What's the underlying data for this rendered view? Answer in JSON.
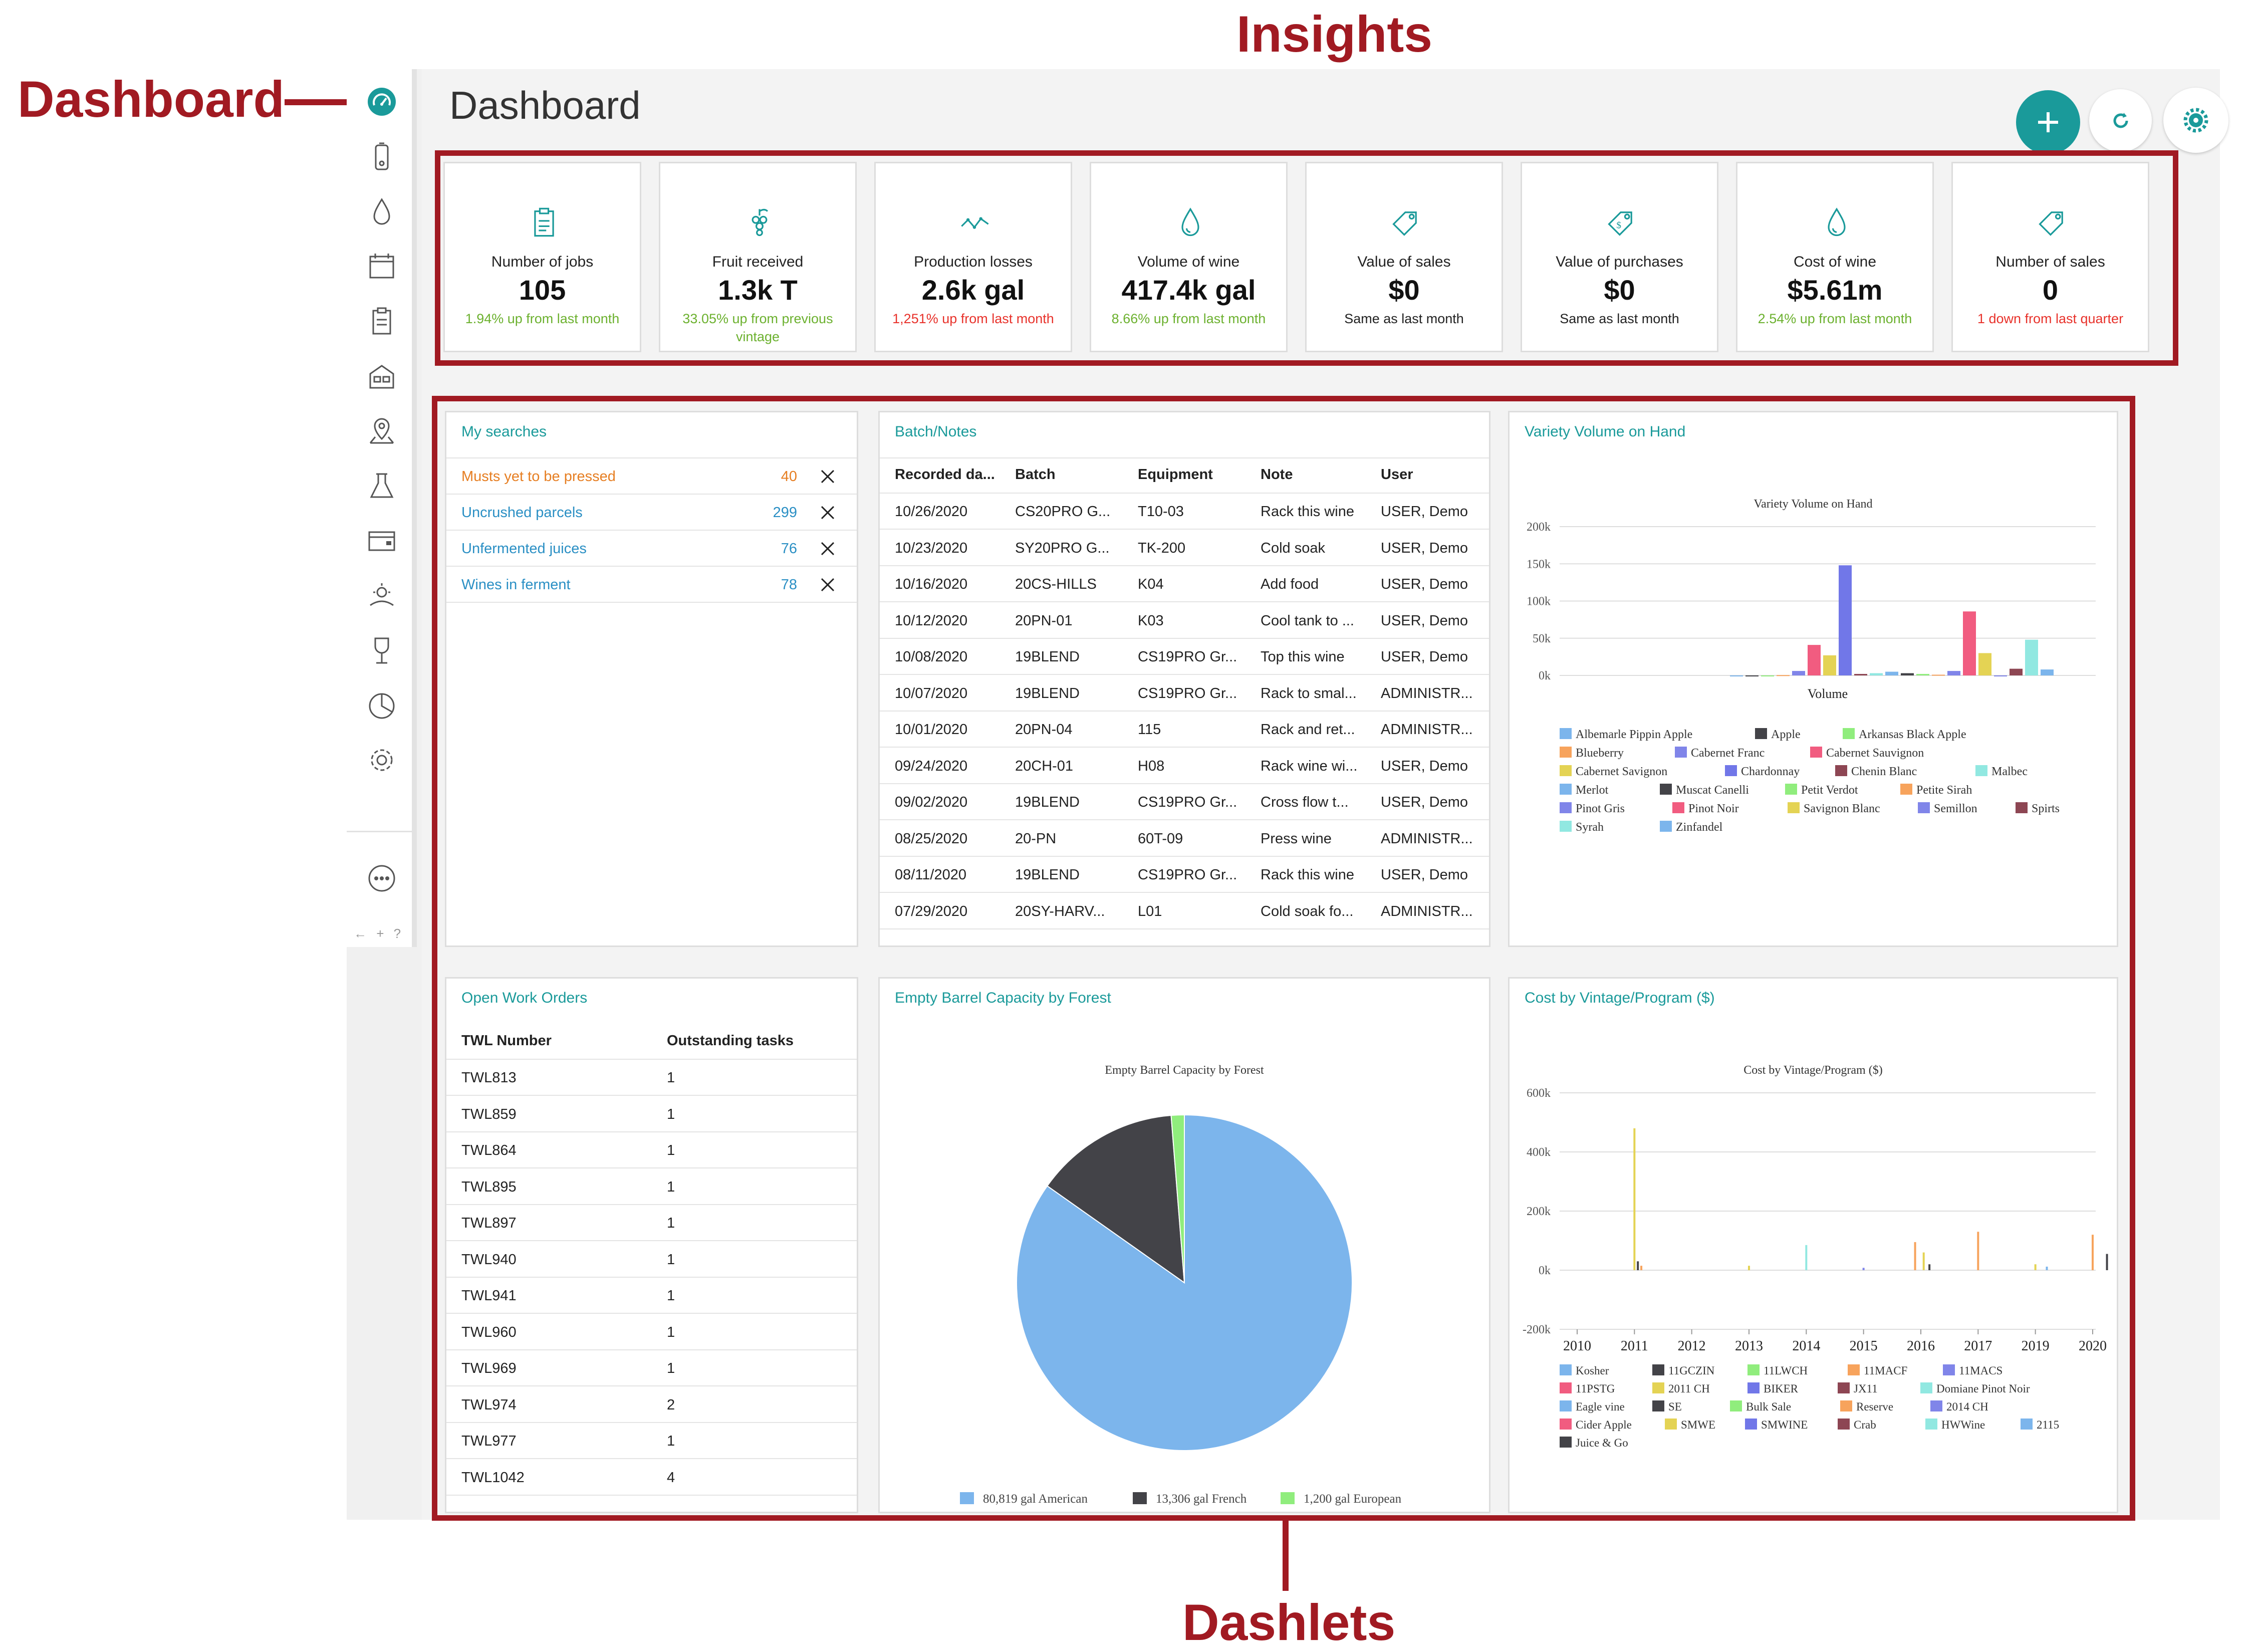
{
  "annotations": {
    "dashboard": "Dashboard",
    "insights": "Insights",
    "dashlets": "Dashlets"
  },
  "page": {
    "title": "Dashboard",
    "footer_icons": "← + ?"
  },
  "colors": {
    "teal": "#1a9a9a",
    "annotation": "#a11a22",
    "green": "#6cb12f",
    "red": "#e8322b",
    "orange": "#e67e22"
  },
  "insights": [
    {
      "title": "Number of jobs",
      "value": "105",
      "trend": "1.94% up from last month",
      "status": "green",
      "icon": "clipboard-icon"
    },
    {
      "title": "Fruit received",
      "value": "1.3k T",
      "trend": "33.05% up from previous vintage",
      "status": "green",
      "icon": "grapes-icon"
    },
    {
      "title": "Production losses",
      "value": "2.6k gal",
      "trend": "1,251% up from last month",
      "status": "red",
      "icon": "trend-line-icon"
    },
    {
      "title": "Volume of wine",
      "value": "417.4k gal",
      "trend": "8.66% up from last month",
      "status": "green",
      "icon": "droplet-icon"
    },
    {
      "title": "Value of sales",
      "value": "$0",
      "trend": "Same as last month",
      "status": "dark",
      "icon": "tag-icon"
    },
    {
      "title": "Value of purchases",
      "value": "$0",
      "trend": "Same as last month",
      "status": "dark",
      "icon": "price-tag-icon"
    },
    {
      "title": "Cost of wine",
      "value": "$5.61m",
      "trend": "2.54% up from last month",
      "status": "green",
      "icon": "droplet-icon"
    },
    {
      "title": "Number of sales",
      "value": "0",
      "trend": "1 down from last quarter",
      "status": "red",
      "icon": "tag-icon"
    }
  ],
  "my_searches": {
    "title": "My searches",
    "items": [
      {
        "label": "Musts yet to be pressed",
        "count": "40",
        "color": "#e67e22"
      },
      {
        "label": "Uncrushed parcels",
        "count": "299",
        "color": "#2a8fc4"
      },
      {
        "label": "Unfermented juices",
        "count": "76",
        "color": "#2a8fc4"
      },
      {
        "label": "Wines in ferment",
        "count": "78",
        "color": "#2a8fc4"
      }
    ]
  },
  "batch_notes": {
    "title": "Batch/Notes",
    "headers": [
      "Recorded da...",
      "Batch",
      "Equipment",
      "Note",
      "User"
    ],
    "rows": [
      [
        "10/26/2020",
        "CS20PRO G...",
        "T10-03",
        "Rack this wine",
        "USER, Demo"
      ],
      [
        "10/23/2020",
        "SY20PRO G...",
        "TK-200",
        "Cold soak",
        "USER, Demo"
      ],
      [
        "10/16/2020",
        "20CS-HILLS",
        "K04",
        "Add food",
        "USER, Demo"
      ],
      [
        "10/12/2020",
        "20PN-01",
        "K03",
        "Cool tank to ...",
        "USER, Demo"
      ],
      [
        "10/08/2020",
        "19BLEND",
        "CS19PRO Gr...",
        "Top this wine",
        "USER, Demo"
      ],
      [
        "10/07/2020",
        "19BLEND",
        "CS19PRO Gr...",
        "Rack to smal...",
        "ADMINISTR..."
      ],
      [
        "10/01/2020",
        "20PN-04",
        "115",
        "Rack and ret...",
        "ADMINISTR..."
      ],
      [
        "09/24/2020",
        "20CH-01",
        "H08",
        "Rack wine wi...",
        "USER, Demo"
      ],
      [
        "09/02/2020",
        "19BLEND",
        "CS19PRO Gr...",
        "Cross flow t...",
        "USER, Demo"
      ],
      [
        "08/25/2020",
        "20-PN",
        "60T-09",
        "Press wine",
        "ADMINISTR..."
      ],
      [
        "08/11/2020",
        "19BLEND",
        "CS19PRO Gr...",
        "Rack this wine",
        "USER, Demo"
      ],
      [
        "07/29/2020",
        "20SY-HARV...",
        "L01",
        "Cold soak fo...",
        "ADMINISTR..."
      ]
    ]
  },
  "work_orders": {
    "title": "Open Work Orders",
    "headers": [
      "TWL Number",
      "Outstanding tasks"
    ],
    "rows": [
      [
        "TWL813",
        "1"
      ],
      [
        "TWL859",
        "1"
      ],
      [
        "TWL864",
        "1"
      ],
      [
        "TWL895",
        "1"
      ],
      [
        "TWL897",
        "1"
      ],
      [
        "TWL940",
        "1"
      ],
      [
        "TWL941",
        "1"
      ],
      [
        "TWL960",
        "1"
      ],
      [
        "TWL969",
        "1"
      ],
      [
        "TWL974",
        "2"
      ],
      [
        "TWL977",
        "1"
      ],
      [
        "TWL1042",
        "4"
      ]
    ]
  },
  "variety_dashlet": {
    "title": "Variety Volume on Hand"
  },
  "barrel_dashlet": {
    "title": "Empty Barrel Capacity by Forest"
  },
  "cost_dashlet": {
    "title": "Cost by Vintage/Program ($)"
  },
  "chart_data": [
    {
      "type": "bar",
      "title": "Variety Volume on Hand",
      "xlabel": "Volume",
      "ylim": [
        0,
        200000
      ],
      "yticks": [
        "0k",
        "50k",
        "100k",
        "150k",
        "200k"
      ],
      "series": [
        {
          "name": "Albemarle Pippin Apple",
          "values": [
            0
          ],
          "color": "#7cb5ec"
        },
        {
          "name": "Apple",
          "values": [
            0
          ],
          "color": "#434348"
        },
        {
          "name": "Arkansas Black Apple",
          "values": [
            0
          ],
          "color": "#90ed7d"
        },
        {
          "name": "Blueberry",
          "values": [
            500
          ],
          "color": "#f7a35c"
        },
        {
          "name": "Cabernet Franc",
          "values": [
            6000
          ],
          "color": "#8085e9"
        },
        {
          "name": "Cabernet Sauvignon",
          "values": [
            41000
          ],
          "color": "#f15c80"
        },
        {
          "name": "Cabernet Savignon",
          "values": [
            27000
          ],
          "color": "#e4d354"
        },
        {
          "name": "Chardonnay",
          "values": [
            148000
          ],
          "color": "#7177e8"
        },
        {
          "name": "Chenin Blanc",
          "values": [
            2000
          ],
          "color": "#8d4653"
        },
        {
          "name": "Malbec",
          "values": [
            3000
          ],
          "color": "#91e8e1"
        },
        {
          "name": "Merlot",
          "values": [
            5000
          ],
          "color": "#7cb5ec"
        },
        {
          "name": "Muscat Canelli",
          "values": [
            3000
          ],
          "color": "#434348"
        },
        {
          "name": "Petit Verdot",
          "values": [
            2000
          ],
          "color": "#90ed7d"
        },
        {
          "name": "Petite Sirah",
          "values": [
            1000
          ],
          "color": "#f7a35c"
        },
        {
          "name": "Pinot Gris",
          "values": [
            6000
          ],
          "color": "#8085e9"
        },
        {
          "name": "Pinot Noir",
          "values": [
            86000
          ],
          "color": "#f15c80"
        },
        {
          "name": "Savignon Blanc",
          "values": [
            30000
          ],
          "color": "#e4d354"
        },
        {
          "name": "Semillon",
          "values": [
            0
          ],
          "color": "#8085e9"
        },
        {
          "name": "Spirts",
          "values": [
            9000
          ],
          "color": "#8d4653"
        },
        {
          "name": "Syrah",
          "values": [
            48000
          ],
          "color": "#91e8e1"
        },
        {
          "name": "Zinfandel",
          "values": [
            8000
          ],
          "color": "#7cb5ec"
        }
      ]
    },
    {
      "type": "pie",
      "title": "Empty Barrel Capacity by Forest",
      "slices": [
        {
          "label": "80,819 gal American",
          "value": 80819,
          "color": "#7cb5ec"
        },
        {
          "label": "13,306 gal French",
          "value": 13306,
          "color": "#434348"
        },
        {
          "label": "1,200 gal European",
          "value": 1200,
          "color": "#90ed7d"
        }
      ]
    },
    {
      "type": "bar",
      "title": "Cost by Vintage/Program ($)",
      "ylim": [
        -200000,
        600000
      ],
      "yticks": [
        "-200k",
        "0k",
        "200k",
        "400k",
        "600k"
      ],
      "categories": [
        "2010",
        "2011",
        "2012",
        "2013",
        "2014",
        "2015",
        "2016",
        "2017",
        "2019",
        "2020"
      ],
      "series": [
        {
          "name": "Kosher",
          "color": "#7cb5ec"
        },
        {
          "name": "11GCZIN",
          "color": "#434348"
        },
        {
          "name": "11LWCH",
          "color": "#90ed7d"
        },
        {
          "name": "11MACF",
          "color": "#f7a35c"
        },
        {
          "name": "11MACS",
          "color": "#8085e9"
        },
        {
          "name": "11PSTG",
          "color": "#f15c80"
        },
        {
          "name": "2011 CH",
          "color": "#e4d354"
        },
        {
          "name": "BIKER",
          "color": "#7177e8"
        },
        {
          "name": "JX11",
          "color": "#8d4653"
        },
        {
          "name": "Domiane Pinot Noir",
          "color": "#91e8e1"
        },
        {
          "name": "Eagle vine",
          "color": "#7cb5ec"
        },
        {
          "name": "SE",
          "color": "#434348"
        },
        {
          "name": "Bulk Sale",
          "color": "#90ed7d"
        },
        {
          "name": "Reserve",
          "color": "#f7a35c"
        },
        {
          "name": "2014 CH",
          "color": "#8085e9"
        },
        {
          "name": "Cider Apple",
          "color": "#f15c80"
        },
        {
          "name": "SMWE",
          "color": "#e4d354"
        },
        {
          "name": "SMWINE",
          "color": "#7177e8"
        },
        {
          "name": "Crab",
          "color": "#8d4653"
        },
        {
          "name": "HWWine",
          "color": "#91e8e1"
        },
        {
          "name": "2115",
          "color": "#7cb5ec"
        },
        {
          "name": "Juice & Go",
          "color": "#434348"
        }
      ],
      "bars": [
        {
          "year_pos": 1.0,
          "value": 480000,
          "color": "#e4d354"
        },
        {
          "year_pos": 1.06,
          "value": 30000,
          "color": "#434348"
        },
        {
          "year_pos": 1.12,
          "value": 15000,
          "color": "#f7a35c"
        },
        {
          "year_pos": 3.0,
          "value": 15000,
          "color": "#e4d354"
        },
        {
          "year_pos": 4.0,
          "value": 85000,
          "color": "#91e8e1"
        },
        {
          "year_pos": 5.0,
          "value": 8000,
          "color": "#8085e9"
        },
        {
          "year_pos": 5.9,
          "value": 95000,
          "color": "#f7a35c"
        },
        {
          "year_pos": 6.05,
          "value": 60000,
          "color": "#e4d354"
        },
        {
          "year_pos": 6.15,
          "value": 20000,
          "color": "#434348"
        },
        {
          "year_pos": 7.0,
          "value": 130000,
          "color": "#f7a35c"
        },
        {
          "year_pos": 8.0,
          "value": 20000,
          "color": "#e4d354"
        },
        {
          "year_pos": 8.2,
          "value": 12000,
          "color": "#7cb5ec"
        },
        {
          "year_pos": 9.0,
          "value": 120000,
          "color": "#f7a35c"
        },
        {
          "year_pos": 9.25,
          "value": 55000,
          "color": "#434348"
        }
      ]
    }
  ]
}
